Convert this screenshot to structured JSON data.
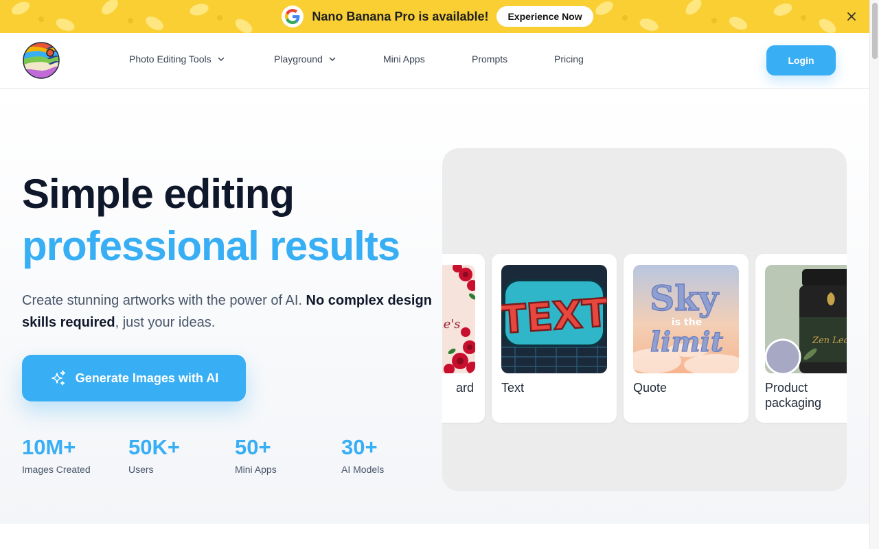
{
  "banner": {
    "text": "Nano Banana Pro is available!",
    "button_label": "Experience Now",
    "icons": {
      "brand": "google-icon",
      "close": "close-icon"
    },
    "color": "#f9cf33"
  },
  "nav": {
    "items": [
      {
        "label": "Photo Editing Tools",
        "has_dropdown": true
      },
      {
        "label": "Playground",
        "has_dropdown": true
      },
      {
        "label": "Mini Apps",
        "has_dropdown": false
      },
      {
        "label": "Prompts",
        "has_dropdown": false
      },
      {
        "label": "Pricing",
        "has_dropdown": false
      }
    ],
    "login_label": "Login"
  },
  "hero": {
    "headline_line1": "Simple editing",
    "headline_line2": "professional results",
    "subtext_regular_1": "Create stunning artworks with the power of AI. ",
    "subtext_bold": "No complex design skills required",
    "subtext_regular_2": ", just your ideas.",
    "cta_label": "Generate Images with AI",
    "cta_icon": "sparkles-icon",
    "stats": [
      {
        "value": "10M+",
        "label": "Images Created"
      },
      {
        "value": "50K+",
        "label": "Users"
      },
      {
        "value": "50+",
        "label": "Mini Apps"
      },
      {
        "value": "30+",
        "label": "AI Models"
      }
    ]
  },
  "showcase": {
    "cards": [
      {
        "label": "ard",
        "image_text": "ne's"
      },
      {
        "label": "Text",
        "image_text": "TEXT"
      },
      {
        "label": "Quote",
        "image_text_1": "Sky",
        "image_text_2": "is the",
        "image_text_3": "limit"
      },
      {
        "label": "Product packaging",
        "image_text": "Zen Leaf"
      }
    ]
  },
  "colors": {
    "accent": "#38aef5",
    "heading": "#0f172a"
  }
}
